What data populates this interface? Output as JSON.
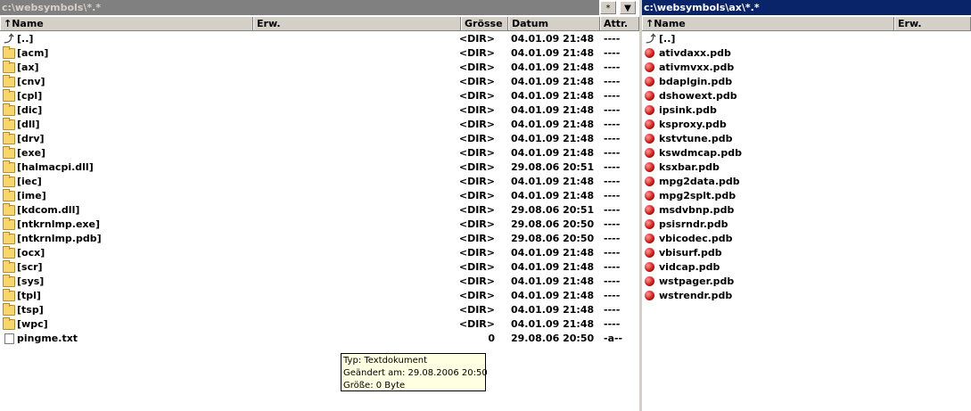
{
  "left_panel": {
    "path": "c:\\websymbols\\*.*",
    "star_button": "*",
    "dropdown_button": "▼",
    "headers": {
      "name": "↑Name",
      "ext": "Erw.",
      "size": "Grösse",
      "date": "Datum",
      "attr": "Attr."
    },
    "rows": [
      {
        "icon": "up",
        "name": "[..]",
        "size": "<DIR>",
        "date": "04.01.09 21:48",
        "attr": "----"
      },
      {
        "icon": "folder",
        "name": "[acm]",
        "size": "<DIR>",
        "date": "04.01.09 21:48",
        "attr": "----"
      },
      {
        "icon": "folder",
        "name": "[ax]",
        "size": "<DIR>",
        "date": "04.01.09 21:48",
        "attr": "----"
      },
      {
        "icon": "folder",
        "name": "[cnv]",
        "size": "<DIR>",
        "date": "04.01.09 21:48",
        "attr": "----"
      },
      {
        "icon": "folder",
        "name": "[cpl]",
        "size": "<DIR>",
        "date": "04.01.09 21:48",
        "attr": "----"
      },
      {
        "icon": "folder",
        "name": "[dic]",
        "size": "<DIR>",
        "date": "04.01.09 21:48",
        "attr": "----"
      },
      {
        "icon": "folder",
        "name": "[dll]",
        "size": "<DIR>",
        "date": "04.01.09 21:48",
        "attr": "----"
      },
      {
        "icon": "folder",
        "name": "[drv]",
        "size": "<DIR>",
        "date": "04.01.09 21:48",
        "attr": "----"
      },
      {
        "icon": "folder",
        "name": "[exe]",
        "size": "<DIR>",
        "date": "04.01.09 21:48",
        "attr": "----"
      },
      {
        "icon": "folder",
        "name": "[halmacpi.dll]",
        "size": "<DIR>",
        "date": "29.08.06 20:51",
        "attr": "----"
      },
      {
        "icon": "folder",
        "name": "[iec]",
        "size": "<DIR>",
        "date": "04.01.09 21:48",
        "attr": "----"
      },
      {
        "icon": "folder",
        "name": "[ime]",
        "size": "<DIR>",
        "date": "04.01.09 21:48",
        "attr": "----"
      },
      {
        "icon": "folder",
        "name": "[kdcom.dll]",
        "size": "<DIR>",
        "date": "29.08.06 20:51",
        "attr": "----"
      },
      {
        "icon": "folder",
        "name": "[ntkrnlmp.exe]",
        "size": "<DIR>",
        "date": "29.08.06 20:50",
        "attr": "----"
      },
      {
        "icon": "folder",
        "name": "[ntkrnlmp.pdb]",
        "size": "<DIR>",
        "date": "29.08.06 20:50",
        "attr": "----"
      },
      {
        "icon": "folder",
        "name": "[ocx]",
        "size": "<DIR>",
        "date": "04.01.09 21:48",
        "attr": "----"
      },
      {
        "icon": "folder",
        "name": "[scr]",
        "size": "<DIR>",
        "date": "04.01.09 21:48",
        "attr": "----"
      },
      {
        "icon": "folder",
        "name": "[sys]",
        "size": "<DIR>",
        "date": "04.01.09 21:48",
        "attr": "----"
      },
      {
        "icon": "folder",
        "name": "[tpl]",
        "size": "<DIR>",
        "date": "04.01.09 21:48",
        "attr": "----"
      },
      {
        "icon": "folder",
        "name": "[tsp]",
        "size": "<DIR>",
        "date": "04.01.09 21:48",
        "attr": "----"
      },
      {
        "icon": "folder",
        "name": "[wpc]",
        "size": "<DIR>",
        "date": "04.01.09 21:48",
        "attr": "----"
      },
      {
        "icon": "doc",
        "name": "pingme.txt",
        "size": "0",
        "date": "29.08.06 20:50",
        "attr": "-a--"
      }
    ]
  },
  "right_panel": {
    "path": "c:\\websymbols\\ax\\*.*",
    "headers": {
      "name": "↑Name",
      "ext": "Erw."
    },
    "rows": [
      {
        "icon": "up",
        "name": "[..]"
      },
      {
        "icon": "pdb",
        "name": "ativdaxx.pdb"
      },
      {
        "icon": "pdb",
        "name": "ativmvxx.pdb"
      },
      {
        "icon": "pdb",
        "name": "bdaplgin.pdb"
      },
      {
        "icon": "pdb",
        "name": "dshowext.pdb"
      },
      {
        "icon": "pdb",
        "name": "ipsink.pdb"
      },
      {
        "icon": "pdb",
        "name": "ksproxy.pdb"
      },
      {
        "icon": "pdb",
        "name": "kstvtune.pdb"
      },
      {
        "icon": "pdb",
        "name": "kswdmcap.pdb"
      },
      {
        "icon": "pdb",
        "name": "ksxbar.pdb"
      },
      {
        "icon": "pdb",
        "name": "mpg2data.pdb"
      },
      {
        "icon": "pdb",
        "name": "mpg2splt.pdb"
      },
      {
        "icon": "pdb",
        "name": "msdvbnp.pdb"
      },
      {
        "icon": "pdb",
        "name": "psisrndr.pdb"
      },
      {
        "icon": "pdb",
        "name": "vbicodec.pdb"
      },
      {
        "icon": "pdb",
        "name": "vbisurf.pdb"
      },
      {
        "icon": "pdb",
        "name": "vidcap.pdb"
      },
      {
        "icon": "pdb",
        "name": "wstpager.pdb"
      },
      {
        "icon": "pdb",
        "name": "wstrendr.pdb"
      }
    ]
  },
  "tooltip": {
    "line1": "Typ: Textdokument",
    "line2": "Geändert am: 29.08.2006 20:50",
    "line3": "Größe: 0 Byte"
  }
}
